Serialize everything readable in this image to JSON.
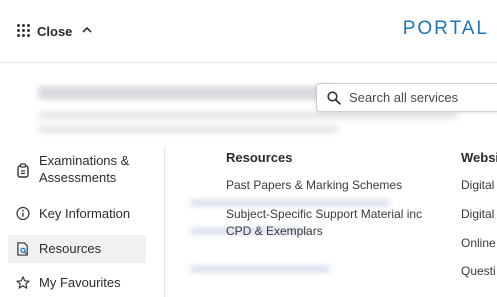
{
  "header": {
    "close_label": "Close",
    "brand": "PORTAL"
  },
  "search": {
    "placeholder": "Search all services"
  },
  "nav": {
    "items": [
      {
        "label": "Examinations & Assessments",
        "line1": "Examinations &",
        "line2": "Assessments",
        "icon": "exam-icon"
      },
      {
        "label": "Key Information",
        "icon": "info-icon"
      },
      {
        "label": "Resources",
        "icon": "resources-icon",
        "active": true
      },
      {
        "label": "My Favourites",
        "icon": "star-icon"
      }
    ]
  },
  "resources": {
    "heading": "Resources",
    "links": [
      {
        "label": "Past Papers & Marking Schemes"
      },
      {
        "label_line1": "Subject-Specific Support Material inc",
        "label_line2": "CPD & Exemplars"
      }
    ]
  },
  "websites": {
    "heading": "Websi",
    "links": [
      "Digital",
      "Digital",
      "Online",
      "Questi"
    ]
  },
  "colors": {
    "accent": "#1b76b8",
    "active_bg": "#f0f1f3",
    "text": "#2b2b2b"
  }
}
